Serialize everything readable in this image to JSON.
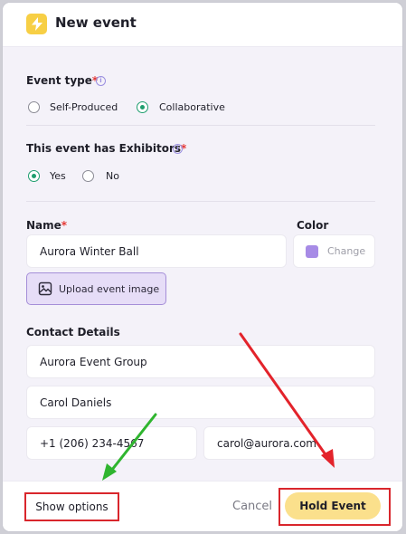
{
  "header": {
    "title": "New event",
    "icon": "lightning-icon"
  },
  "event_type": {
    "label": "Event type",
    "required_mark": "*",
    "options": [
      {
        "label": "Self-Produced",
        "selected": false
      },
      {
        "label": "Collaborative",
        "selected": true
      }
    ]
  },
  "exhibitors": {
    "label": "This event has Exhibitors",
    "required_mark": "*",
    "options": [
      {
        "label": "Yes",
        "selected": true
      },
      {
        "label": "No",
        "selected": false
      }
    ]
  },
  "name": {
    "label": "Name",
    "required_mark": "*",
    "value": "Aurora Winter Ball"
  },
  "color": {
    "label": "Color",
    "change_label": "Change",
    "swatch": "#a78be6"
  },
  "upload": {
    "label": "Upload event image"
  },
  "contact": {
    "label": "Contact Details",
    "organization": "Aurora Event Group",
    "person": "Carol Daniels",
    "phone": "+1 (206) 234-4567",
    "email": "carol@aurora.com"
  },
  "footer": {
    "show_options": "Show options",
    "cancel": "Cancel",
    "submit": "Hold Event"
  },
  "colors": {
    "accent_green": "#1e9e6e",
    "highlight_red": "#d9262c",
    "primary_yellow": "#fbe08c"
  }
}
